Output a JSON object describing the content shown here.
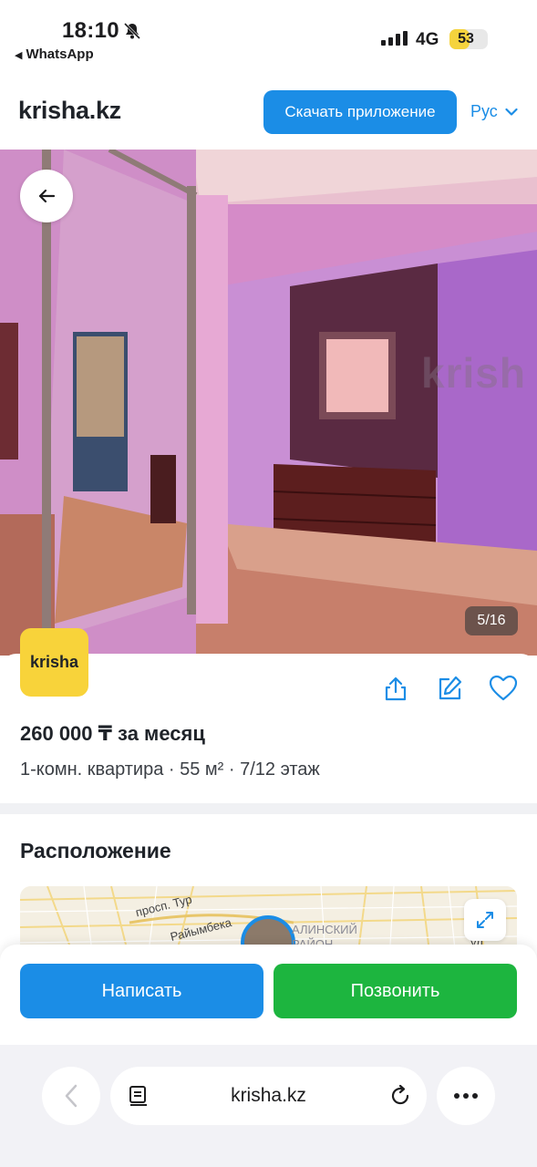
{
  "status_bar": {
    "time": "18:10",
    "back_app": "WhatsApp",
    "network": "4G",
    "battery_percent": "53",
    "battery_level": 0.53
  },
  "header": {
    "logo": "krisha.kz",
    "download_label": "Скачать приложение",
    "language": "Рус"
  },
  "gallery": {
    "counter": "5/16",
    "watermark": "krish"
  },
  "listing": {
    "badge": "krisha",
    "price": "260 000 ₸ за месяц",
    "summary": "1-комн. квартира · 55 м² · 7/12 этаж"
  },
  "location": {
    "title": "Расположение",
    "map_labels": [
      "просп. Тур",
      "Райымбека",
      "АЛИНСКИЙ",
      "РАЙОН",
      "ул."
    ]
  },
  "actions": {
    "write": "Написать",
    "call": "Позвонить"
  },
  "browser": {
    "url": "krisha.kz"
  },
  "colors": {
    "brand_blue": "#1b8de6",
    "call_green": "#1db53f",
    "badge_yellow": "#f8d33a"
  },
  "icons": [
    "bell-slash-icon",
    "signal-icon",
    "chevron-down-icon",
    "arrow-left-icon",
    "share-icon",
    "edit-icon",
    "heart-icon",
    "expand-icon",
    "chevron-left-icon",
    "reader-icon",
    "reload-icon",
    "more-icon"
  ]
}
